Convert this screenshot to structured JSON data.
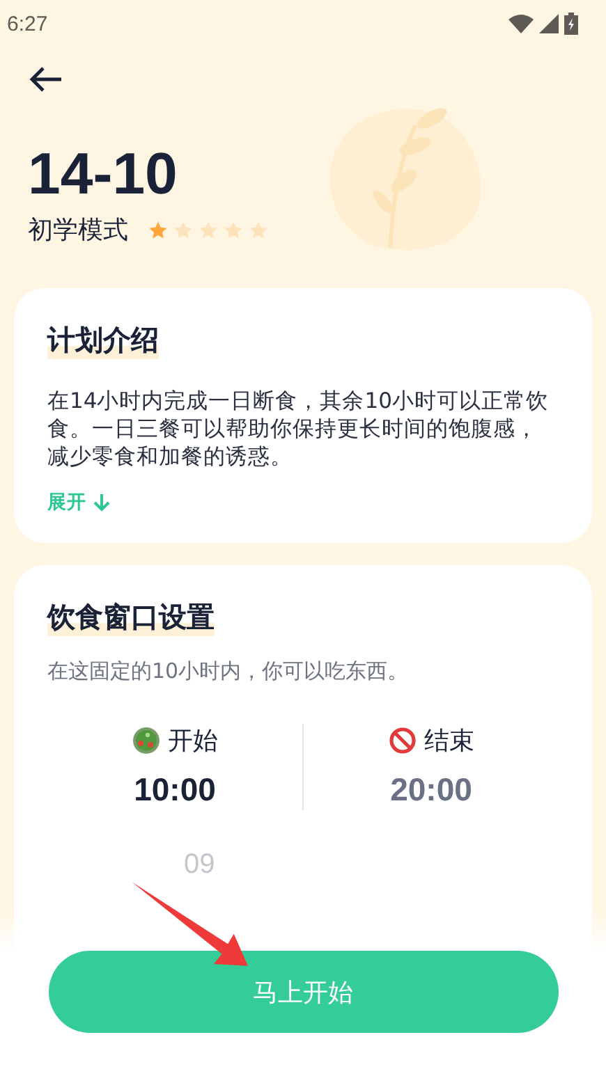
{
  "status_bar": {
    "time": "6:27"
  },
  "header": {
    "title": "14-10",
    "mode": "初学模式",
    "stars": 1
  },
  "intro_card": {
    "title": "计划介绍",
    "body": "在14小时内完成一日断食，其余10小时可以正常饮食。一日三餐可以帮助你保持更长时间的饱腹感，减少零食和加餐的诱惑。",
    "expand_link": "展开"
  },
  "window_card": {
    "title": "饮食窗口设置",
    "subtitle": "在这固定的10小时内，你可以吃东西。",
    "columns": [
      {
        "kind": "start",
        "label": "开始",
        "time": "10:00"
      },
      {
        "kind": "end",
        "label": "结束",
        "time": "20:00"
      }
    ],
    "picker_next": "09"
  },
  "start_button": {
    "label": "马上开始"
  }
}
